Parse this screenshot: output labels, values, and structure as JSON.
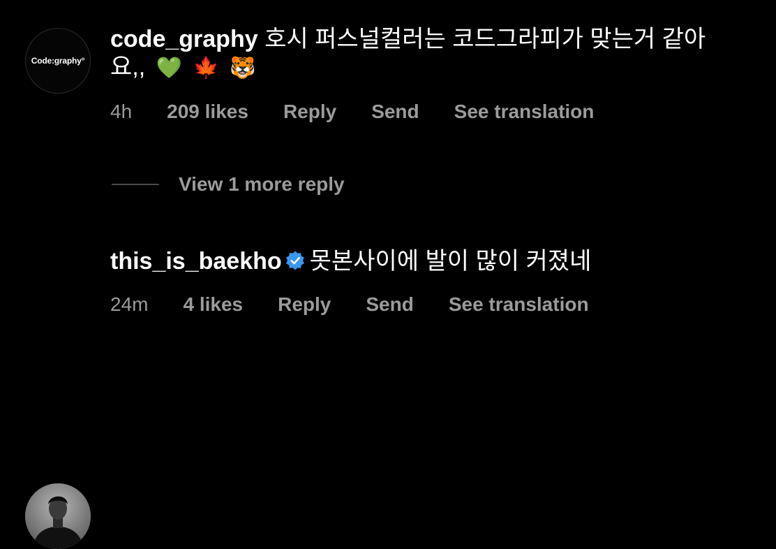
{
  "comments": [
    {
      "username": "code_graphy",
      "avatar_label": "Code:graphy°",
      "text_line1": "호시 퍼스널컬러는 코드그라피가 맞는거 같아",
      "text_line2": "요,,",
      "emojis": [
        "💚",
        "🍁",
        "🐯"
      ],
      "time": "4h",
      "likes": "209 likes",
      "reply": "Reply",
      "send": "Send",
      "translate": "See translation",
      "view_more": "View 1 more reply"
    },
    {
      "username": "this_is_baekho",
      "verified": true,
      "text": "못본사이에 발이 많이 커졌네",
      "time": "24m",
      "likes": "4 likes",
      "reply": "Reply",
      "send": "Send",
      "translate": "See translation"
    }
  ],
  "colors": {
    "background": "#000000",
    "primary_text": "#ffffff",
    "secondary_text": "#9b9b9b",
    "verified_blue": "#3897f0"
  }
}
